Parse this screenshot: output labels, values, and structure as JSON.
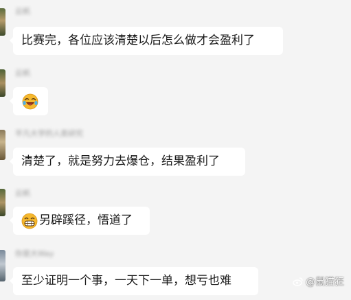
{
  "messages": [
    {
      "sender": "云帆",
      "text": "比赛完，各位应该清楚以后怎么做才会盈利了"
    },
    {
      "sender": "云帆",
      "emoji": "laughing-crying-emoji"
    },
    {
      "sender": "平凡大学的人类研究",
      "text": "清楚了，就是努力去爆仓，结果盈利了"
    },
    {
      "sender": "云帆",
      "emoji": "grinning-emoji",
      "text": "另辟蹊径，悟道了"
    },
    {
      "sender": "你是大Way",
      "text": "至少证明一个事，一天下一单，想亏也难"
    }
  ],
  "watermark": {
    "icon": "weibo-icon",
    "text": "@鼠猫狂"
  },
  "colors": {
    "background": "#f4f4f4",
    "bubble": "#ffffff",
    "text": "#1a1a1a",
    "name": "#9a9a9a"
  }
}
